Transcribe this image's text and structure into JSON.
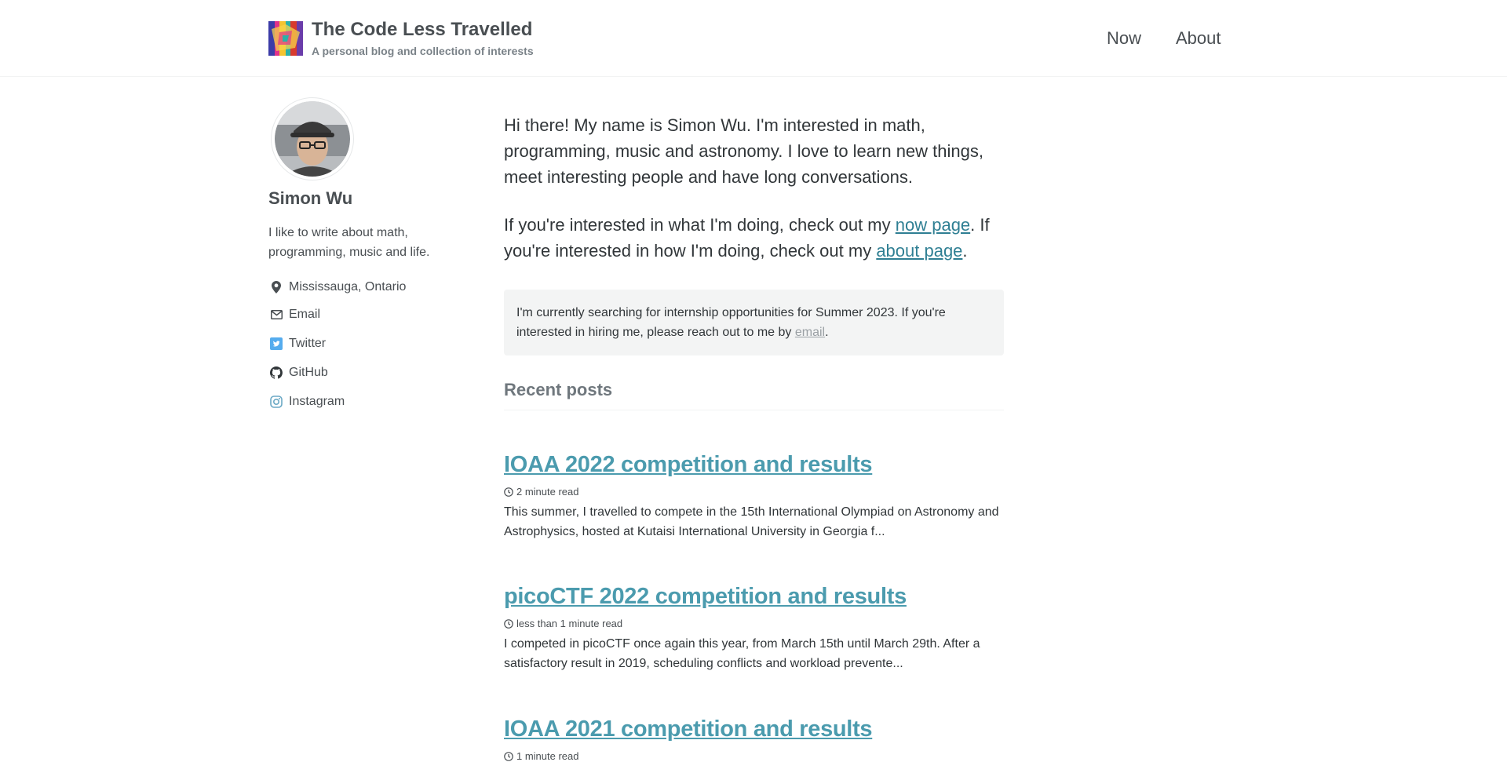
{
  "site": {
    "title": "The Code Less Travelled",
    "subtitle": "A personal blog and collection of interests",
    "logo_icon": "colorful-mosaic-logo"
  },
  "nav": {
    "items": [
      {
        "label": "Now"
      },
      {
        "label": "About"
      }
    ]
  },
  "author": {
    "name": "Simon Wu",
    "bio": "I like to write about math, programming, music and life.",
    "links": [
      {
        "label": "Mississauga, Ontario",
        "icon": "location-pin-icon"
      },
      {
        "label": "Email",
        "icon": "envelope-icon"
      },
      {
        "label": "Twitter",
        "icon": "twitter-icon"
      },
      {
        "label": "GitHub",
        "icon": "github-icon"
      },
      {
        "label": "Instagram",
        "icon": "instagram-icon"
      }
    ]
  },
  "intro": {
    "p1": "Hi there! My name is Simon Wu. I'm interested in math, programming, music and astronomy. I love to learn new things, meet interesting people and have long conversations.",
    "p2_before": "If you're interested in what I'm doing, check out my ",
    "p2_link1": "now page",
    "p2_middle": ". If you're interested in how I'm doing, check out my ",
    "p2_link2": "about page",
    "p2_after": "."
  },
  "notice": {
    "text_before": "I'm currently searching for internship opportunities for Summer 2023. If you're interested in hiring me, please reach out to me by ",
    "link": "email",
    "text_after": "."
  },
  "recent": {
    "title": "Recent posts",
    "posts": [
      {
        "title": "IOAA 2022 competition and results",
        "read_time": "2 minute read",
        "excerpt": "This summer, I travelled to compete in the 15th International Olympiad on Astronomy and Astrophysics, hosted at Kutaisi International University in Georgia f..."
      },
      {
        "title": "picoCTF 2022 competition and results",
        "read_time": "less than 1 minute read",
        "excerpt": "I competed in picoCTF once again this year, from March 15th until March 29th. After a satisfactory result in 2019, scheduling conflicts and workload prevente..."
      },
      {
        "title": "IOAA 2021 competition and results",
        "read_time": "1 minute read",
        "excerpt": ""
      }
    ]
  },
  "colors": {
    "link": "#2f7f93",
    "post_title": "#4b9bae",
    "notice_bg": "#f3f4f4",
    "twitter": "#55acee"
  }
}
